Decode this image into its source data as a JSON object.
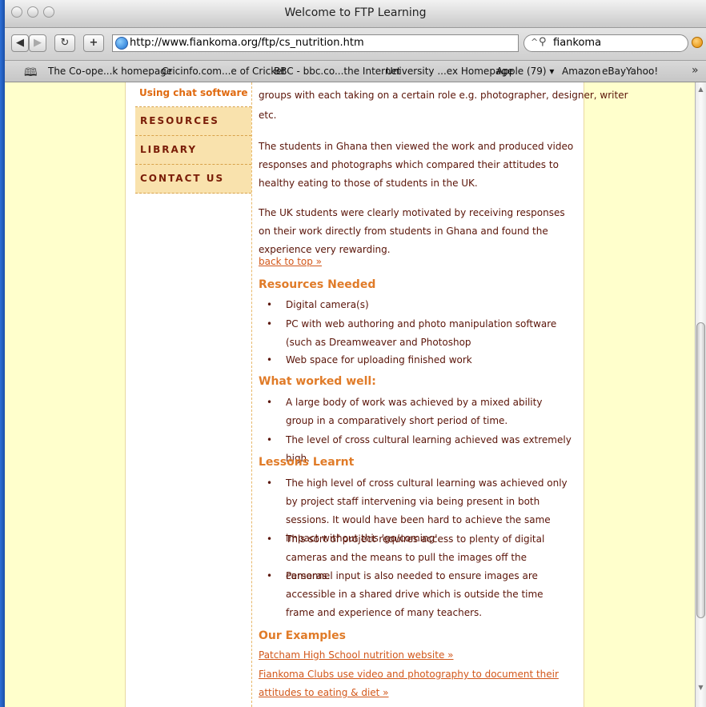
{
  "window": {
    "title": "Welcome to FTP Learning"
  },
  "toolbar": {
    "back_icon": "back-arrow-icon",
    "forward_icon": "forward-arrow-icon",
    "reload_icon": "reload-icon",
    "add_label": "+",
    "url": "http://www.fiankoma.org/ftp/cs_nutrition.htm",
    "search_value": "fiankoma"
  },
  "bookmarks": [
    "The Co-ope...k homepage",
    "Cricinfo.com...e of Cricket",
    "BBC - bbc.co...the Internet",
    "University ...ex Homepage",
    "Apple (79) ▾",
    "Amazon",
    "eBay",
    "Yahoo!"
  ],
  "sidebar": {
    "current": "Using chat software",
    "items": [
      "RESOURCES",
      "LIBRARY",
      "CONTACT US"
    ]
  },
  "content": {
    "intro_line1": "groups with each taking on a certain role e.g. photographer, designer, writer",
    "intro_line2": "etc.",
    "para1": "The students in Ghana then viewed the work and produced video responses and photographs which compared their attitudes to healthy eating to those of students in the UK.",
    "para2": "The UK students were clearly motivated by receiving responses on their work directly from students in Ghana and found the experience very rewarding.",
    "back_to_top": "back to top »",
    "resources_heading": "Resources Needed",
    "resources": [
      "Digital camera(s)",
      "PC with web authoring and photo manipulation software (such as Dreamweaver and Photoshop",
      "Web space for uploading finished work"
    ],
    "worked_heading": "What worked well:",
    "worked": [
      "A large body of work was achieved by a mixed ability group in a comparatively short period of time.",
      "The level of cross cultural learning achieved was extremely high."
    ],
    "lessons_heading": "Lessons Learnt",
    "lessons": [
      "The high level of cross cultural learning was achieved only by project staff intervening via being present in both sessions. It would have been hard to achieve the same impact without this 'go/coming'.",
      "This sort of project requires access to plenty of digital cameras and the means to pull the images off the cameras.",
      "Personnel input is also needed to ensure images are accessible in a shared drive which is outside the time frame and experience of many teachers."
    ],
    "examples_heading": "Our Examples",
    "example1": "Patcham High School nutrition website »",
    "example2": "Fiankoma Clubs use video and photography to document their attitudes to eating & diet »"
  }
}
